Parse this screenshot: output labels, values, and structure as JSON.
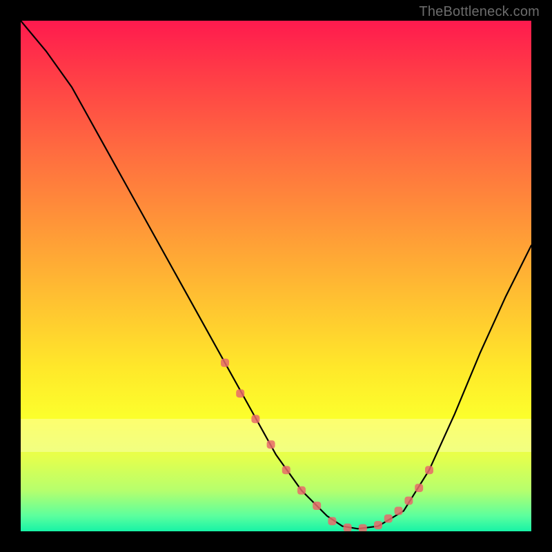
{
  "attribution": "TheBottleneck.com",
  "colors": {
    "background": "#000000",
    "gradient_top": "#ff1a4e",
    "gradient_bottom": "#17f3a6",
    "curve": "#000000",
    "marker": "#e86a6a"
  },
  "chart_data": {
    "type": "line",
    "title": "",
    "xlabel": "",
    "ylabel": "",
    "xlim": [
      0,
      100
    ],
    "ylim": [
      0,
      100
    ],
    "series": [
      {
        "name": "curve",
        "x": [
          0,
          5,
          10,
          15,
          20,
          25,
          30,
          35,
          40,
          45,
          50,
          55,
          60,
          63,
          66,
          70,
          75,
          80,
          85,
          90,
          95,
          100
        ],
        "y": [
          100,
          94,
          87,
          78,
          69,
          60,
          51,
          42,
          33,
          24,
          15,
          8,
          3,
          1,
          0.5,
          1,
          4,
          12,
          23,
          35,
          46,
          56
        ]
      }
    ],
    "markers": {
      "name": "highlighted-points",
      "x": [
        40,
        43,
        46,
        49,
        52,
        55,
        58,
        61,
        64,
        67,
        70,
        72,
        74,
        76,
        78,
        80
      ],
      "y": [
        33,
        27,
        22,
        17,
        12,
        8,
        5,
        2,
        0.7,
        0.6,
        1.2,
        2.5,
        4,
        6,
        8.5,
        12
      ]
    }
  }
}
